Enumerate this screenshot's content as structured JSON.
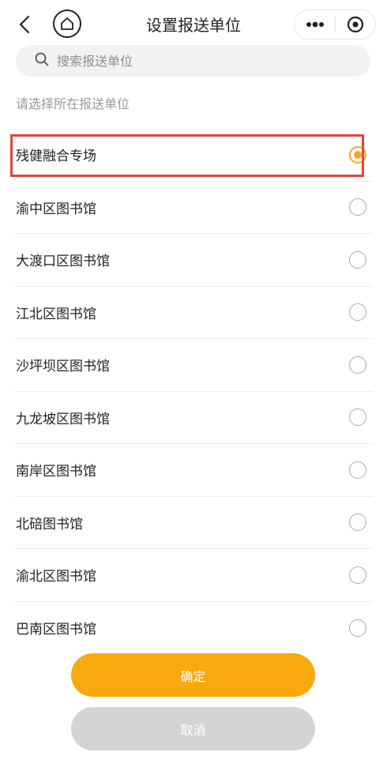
{
  "header": {
    "title": "设置报送单位",
    "back_icon": "chevron-left-icon",
    "home_icon": "home-icon",
    "more_icon": "more-dots-icon",
    "close_icon": "target-close-icon"
  },
  "search": {
    "placeholder": "搜索报送单位",
    "value": ""
  },
  "hint": "请选择所在报送单位",
  "units": [
    {
      "label": "残健融合专场",
      "selected": true
    },
    {
      "label": "渝中区图书馆",
      "selected": false
    },
    {
      "label": "大渡口区图书馆",
      "selected": false
    },
    {
      "label": "江北区图书馆",
      "selected": false
    },
    {
      "label": "沙坪坝区图书馆",
      "selected": false
    },
    {
      "label": "九龙坡区图书馆",
      "selected": false
    },
    {
      "label": "南岸区图书馆",
      "selected": false
    },
    {
      "label": "北碚图书馆",
      "selected": false
    },
    {
      "label": "渝北区图书馆",
      "selected": false
    },
    {
      "label": "巴南区图书馆",
      "selected": false
    }
  ],
  "buttons": {
    "confirm": "确定",
    "cancel": "取消"
  },
  "colors": {
    "accent": "#f7a90d",
    "highlight": "#e0463a",
    "cancel": "#d4d4d4"
  }
}
